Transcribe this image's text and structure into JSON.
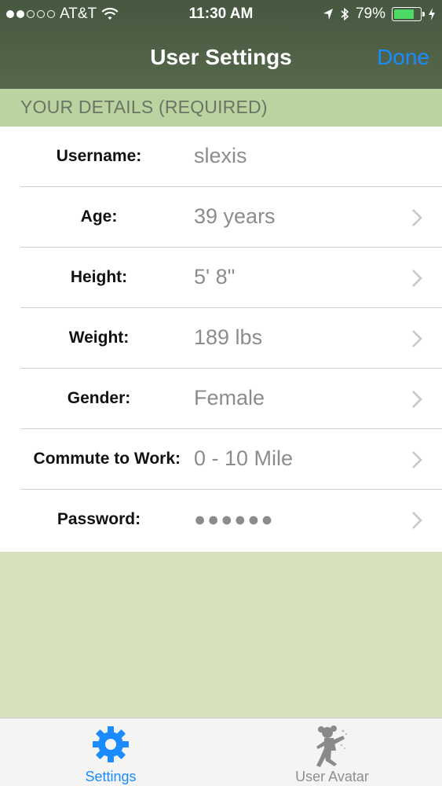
{
  "status_bar": {
    "carrier": "AT&T",
    "time": "11:30 AM",
    "battery": "79%",
    "battery_level": 0.79,
    "signal_bars_filled": 2,
    "signal_bars_total": 5
  },
  "nav": {
    "title": "User Settings",
    "done_label": "Done"
  },
  "section": {
    "header": "YOUR DETAILS (REQUIRED)"
  },
  "rows": [
    {
      "label": "Username:",
      "value": "slexis",
      "has_chevron": false
    },
    {
      "label": "Age:",
      "value": "39 years",
      "has_chevron": true
    },
    {
      "label": "Height:",
      "value": "5' 8\"",
      "has_chevron": true
    },
    {
      "label": "Weight:",
      "value": "189 lbs",
      "has_chevron": true
    },
    {
      "label": "Gender:",
      "value": "Female",
      "has_chevron": true
    },
    {
      "label": "Commute to Work:",
      "value": "0 - 10 Mile",
      "has_chevron": true
    },
    {
      "label": "Password:",
      "value": "●●●●●●",
      "has_chevron": true
    }
  ],
  "tabs": [
    {
      "label": "Settings",
      "icon": "gear-icon",
      "active": true
    },
    {
      "label": "User Avatar",
      "icon": "avatar-figure-icon",
      "active": false
    }
  ],
  "colors": {
    "accent": "#1a8cff",
    "header_bg": "#4f6046",
    "section_bg": "#b9d3a1",
    "page_bg": "#d6e1bd",
    "battery_fill": "#4cd964"
  }
}
